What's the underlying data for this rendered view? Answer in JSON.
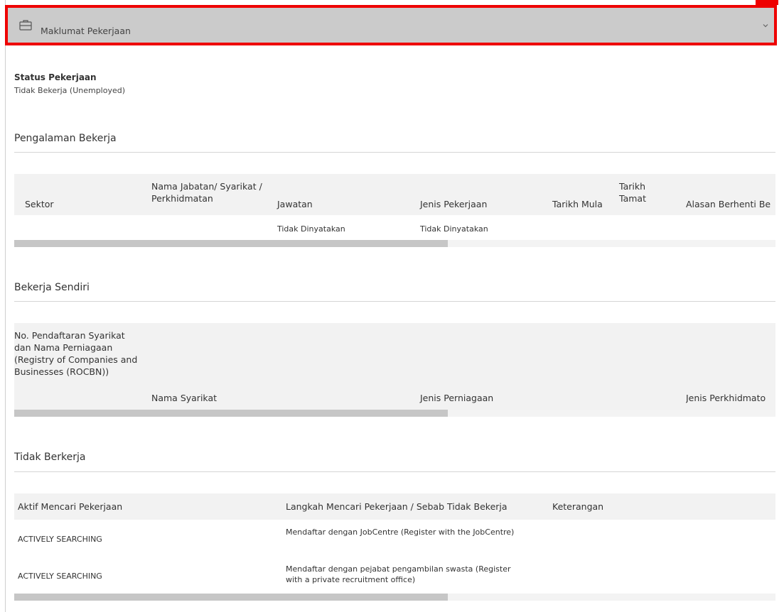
{
  "accordion": {
    "title": "Maklumat Pekerjaan"
  },
  "status": {
    "label": "Status Pekerjaan",
    "value": "Tidak Bekerja (Unemployed)"
  },
  "work_experience": {
    "title": "Pengalaman Bekerja",
    "headers": [
      "Sektor",
      "Nama Jabatan/ Syarikat / Perkhidmatan",
      "Jawatan",
      "Jenis Pekerjaan",
      "Tarikh Mula",
      "Tarikh Tamat",
      "Alasan Berhenti Be"
    ],
    "rows": [
      [
        "",
        "",
        "Tidak Dinyatakan",
        "Tidak Dinyatakan",
        "",
        "",
        ""
      ]
    ]
  },
  "self_employed": {
    "title": "Bekerja Sendiri",
    "headers": [
      "No. Pendaftaran Syarikat dan Nama Perniagaan (Registry of Companies and Businesses (ROCBN))",
      "Nama Syarikat",
      "Jenis Perniagaan",
      "Jenis Perkhidmato"
    ]
  },
  "unemployed": {
    "title": "Tidak Berkerja",
    "headers": [
      "Aktif Mencari Pekerjaan",
      "Langkah Mencari Pekerjaan / Sebab Tidak Bekerja",
      "Keterangan"
    ],
    "rows": [
      [
        "ACTIVELY SEARCHING",
        "Mendaftar dengan JobCentre (Register with the JobCentre)",
        ""
      ],
      [
        "ACTIVELY SEARCHING",
        "Mendaftar dengan pejabat pengambilan swasta (Register with a private recruitment office)",
        ""
      ]
    ]
  },
  "colors": {
    "header_bg": "#cbcbcb",
    "highlight_border": "#ee0000",
    "table_header_bg": "#f2f2f2"
  }
}
